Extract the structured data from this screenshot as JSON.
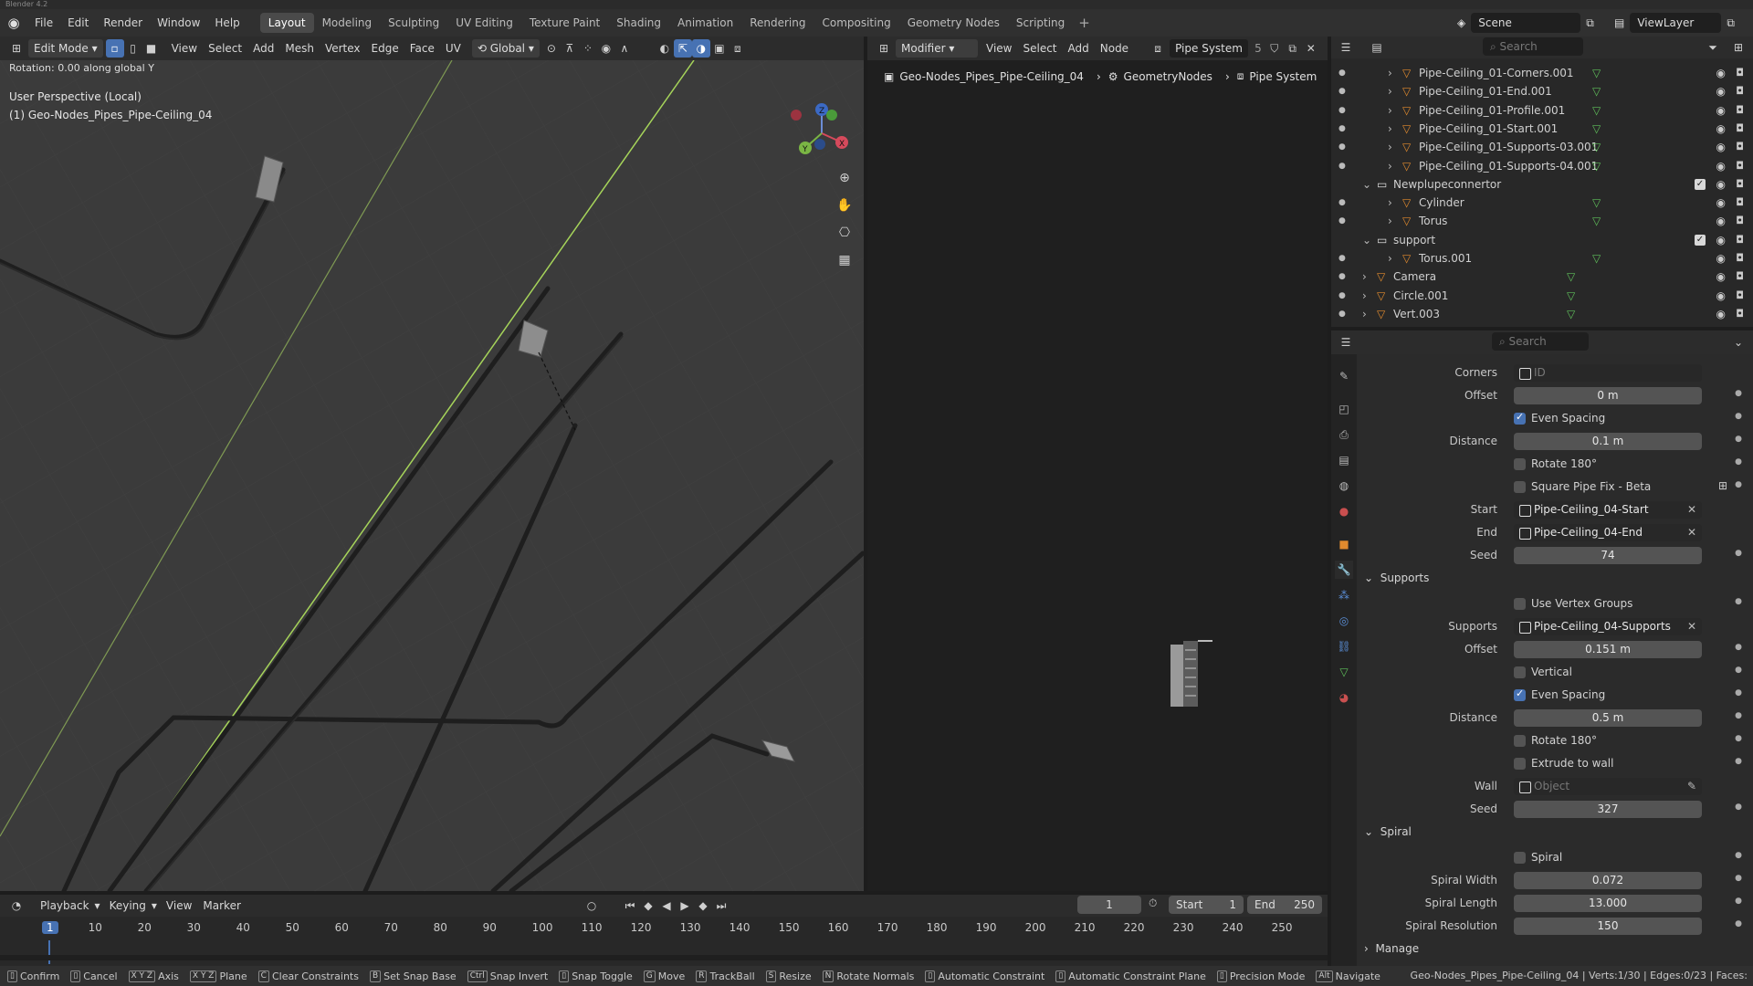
{
  "window": {
    "title": "Blender 4.2"
  },
  "menubar": {
    "items": [
      "File",
      "Edit",
      "Render",
      "Window",
      "Help"
    ],
    "workspaces": [
      "Layout",
      "Modeling",
      "Sculpting",
      "UV Editing",
      "Texture Paint",
      "Shading",
      "Animation",
      "Rendering",
      "Compositing",
      "Geometry Nodes",
      "Scripting"
    ],
    "active_workspace": "Layout",
    "scene": "Scene",
    "view_layer": "ViewLayer"
  },
  "viewport_header": {
    "mode": "Edit Mode",
    "menus": [
      "View",
      "Select",
      "Add",
      "Mesh",
      "Vertex",
      "Edge",
      "Face",
      "UV"
    ],
    "transform_orientation": "Global"
  },
  "viewport": {
    "status": "Rotation: 0.00 along global Y",
    "perspective": "User Perspective (Local)",
    "object": "(1) Geo-Nodes_Pipes_Pipe-Ceiling_04",
    "gizmo_axes": [
      "Z",
      "Y",
      "X"
    ]
  },
  "node_editor": {
    "type": "Modifier",
    "menus": [
      "View",
      "Select",
      "Add",
      "Node"
    ],
    "node_tree": "Pipe System",
    "users": "5",
    "breadcrumb": [
      "Geo-Nodes_Pipes_Pipe-Ceiling_04",
      "GeometryNodes",
      "Pipe System"
    ]
  },
  "outliner": {
    "search_placeholder": "Search",
    "rows": [
      {
        "label": "Pipe-Ceiling_01-Corners.001",
        "indent": 2
      },
      {
        "label": "Pipe-Ceiling_01-End.001",
        "indent": 2
      },
      {
        "label": "Pipe-Ceiling_01-Profile.001",
        "indent": 2
      },
      {
        "label": "Pipe-Ceiling_01-Start.001",
        "indent": 2
      },
      {
        "label": "Pipe-Ceiling_01-Supports-03.001",
        "indent": 2
      },
      {
        "label": "Pipe-Ceiling_01-Supports-04.001",
        "indent": 2
      },
      {
        "label": "Newplupeconnertor",
        "indent": 1,
        "collection": true
      },
      {
        "label": "Cylinder",
        "indent": 2
      },
      {
        "label": "Torus",
        "indent": 2
      },
      {
        "label": "support",
        "indent": 1,
        "collection": true
      },
      {
        "label": "Torus.001",
        "indent": 2
      },
      {
        "label": "Camera",
        "indent": 1
      },
      {
        "label": "Circle.001",
        "indent": 1
      },
      {
        "label": "Vert.003",
        "indent": 1
      }
    ]
  },
  "properties": {
    "search_placeholder": "Search",
    "corners_label": "Corners",
    "corners_placeholder": "ID",
    "offset_label": "Offset",
    "offset_value": "0 m",
    "even_spacing_label": "Even Spacing",
    "distance_label": "Distance",
    "distance_value": "0.1 m",
    "rotate_label": "Rotate 180°",
    "square_fix_label": "Square Pipe Fix - Beta",
    "start_label": "Start",
    "start_value": "Pipe-Ceiling_04-Start",
    "end_label": "End",
    "end_value": "Pipe-Ceiling_04-End",
    "seed_label": "Seed",
    "seed_value": "74",
    "supports_section": "Supports",
    "use_vertex_groups_label": "Use Vertex Groups",
    "supports_label": "Supports",
    "supports_value": "Pipe-Ceiling_04-Supports",
    "supports_offset_value": "0.151 m",
    "vertical_label": "Vertical",
    "supports_distance_value": "0.5 m",
    "extrude_label": "Extrude to wall",
    "wall_label": "Wall",
    "wall_placeholder": "Object",
    "supports_seed_value": "327",
    "spiral_section": "Spiral",
    "spiral_label": "Spiral",
    "spiral_width_label": "Spiral Width",
    "spiral_width_value": "0.072",
    "spiral_length_label": "Spiral Length",
    "spiral_length_value": "13.000",
    "spiral_resolution_label": "Spiral Resolution",
    "spiral_resolution_value": "150",
    "manage_section": "Manage"
  },
  "timeline": {
    "menus": [
      "Playback",
      "Keying",
      "View",
      "Marker"
    ],
    "current_frame": "1",
    "start_label": "Start",
    "start_value": "1",
    "end_label": "End",
    "end_value": "250",
    "ticks": [
      "1",
      "10",
      "20",
      "30",
      "40",
      "50",
      "60",
      "70",
      "80",
      "90",
      "100",
      "110",
      "120",
      "130",
      "140",
      "150",
      "160",
      "170",
      "180",
      "190",
      "200",
      "210",
      "220",
      "230",
      "240",
      "250"
    ]
  },
  "statusbar": {
    "items": [
      "Confirm",
      "Cancel",
      "Axis",
      "Plane",
      "Clear Constraints",
      "Set Snap Base",
      "Snap Invert",
      "Snap Toggle",
      "Move",
      "TrackBall",
      "Resize",
      "Rotate Normals",
      "Automatic Constraint",
      "Automatic Constraint Plane",
      "Precision Mode",
      "Navigate"
    ],
    "keys": [
      "",
      "",
      "X Y Z",
      "X Y Z",
      "C",
      "B",
      "Ctrl",
      "",
      "G",
      "R",
      "S",
      "N",
      "",
      "",
      "",
      "Alt"
    ],
    "info": "Geo-Nodes_Pipes_Pipe-Ceiling_04 | Verts:1/30 | Edges:0/23 | Faces:"
  },
  "colors": {
    "accent": "#4772b3",
    "viewport_bg": "#3b3b3b",
    "highlight_line": "#a6d45a"
  }
}
